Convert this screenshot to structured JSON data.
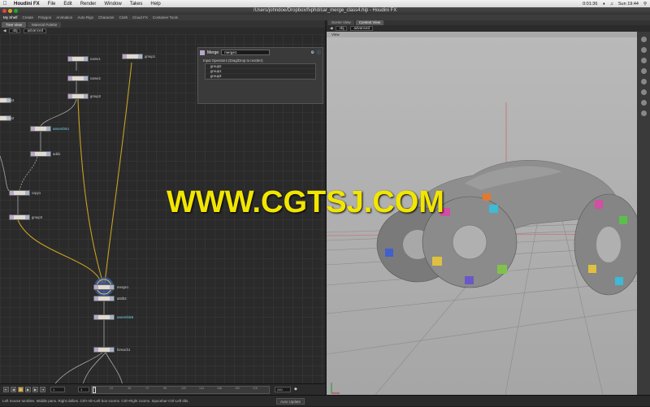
{
  "menubar": {
    "app_name": "Houdini FX",
    "items": [
      "File",
      "Edit",
      "Render",
      "Window",
      "Takes",
      "Help"
    ],
    "clock": "Sun 19:44",
    "timer": "0:01:36"
  },
  "window": {
    "title": "/Users/johndoe/Dropbox/fxphd/car_merge_class4.hip - Houdini FX"
  },
  "houdini_menu": [
    "Create",
    "Polygon",
    "Animation",
    "Auto Rigs",
    "Character",
    "Cloth",
    "Cloud FX",
    "Container Tools"
  ],
  "shelf": {
    "active": "My Shelf"
  },
  "left_pane": {
    "tabs": [
      "Tree View",
      "Material Palette"
    ],
    "path": [
      "obj",
      "advanced"
    ]
  },
  "nodes": [
    {
      "id": "name1",
      "label": "name1"
    },
    {
      "id": "name2",
      "label": "name2"
    },
    {
      "id": "group1",
      "label": "group1"
    },
    {
      "id": "group2",
      "label": "group2"
    },
    {
      "id": "fuse3",
      "label": "fuse3"
    },
    {
      "id": "fuse2",
      "label": "fuse2"
    },
    {
      "id": "assemble1",
      "label": "assemble1"
    },
    {
      "id": "add1",
      "label": "add1"
    },
    {
      "id": "copy1",
      "label": "copy1"
    },
    {
      "id": "group3",
      "label": "group3"
    },
    {
      "id": "merge1",
      "label": "merge1"
    },
    {
      "id": "attrib3",
      "label": "attrib3"
    },
    {
      "id": "assemble5",
      "label": "assemble5"
    },
    {
      "id": "foreach1",
      "label": "foreach1"
    }
  ],
  "params": {
    "type": "Merge",
    "node_name": "merge1",
    "section": "Input Operators (Drag/Drop to reorder)",
    "inputs": [
      "group2",
      "group1",
      "group3"
    ]
  },
  "right_pane": {
    "tabs": [
      "Scene View",
      "Context View"
    ],
    "path": [
      "obj",
      "advanced"
    ],
    "view_label": "View"
  },
  "timeline": {
    "start": "1",
    "current": "1",
    "end": "240",
    "ticks": [
      "1",
      "24",
      "48",
      "72",
      "96",
      "120",
      "144",
      "168",
      "192",
      "216"
    ]
  },
  "status": {
    "hint": "Left mouse tumbles. Middle pans. Right dollies. Ctrl+Alt+Left box-zooms. Ctrl+Right zooms. Spacebar-Ctrl-Left tilts.",
    "auto_update": "Auto Update"
  },
  "watermark": "WWW.CGTSJ.COM",
  "colors": {
    "accent": "#e0b400",
    "wire": "#c8a020",
    "watermark": "#f2e600"
  }
}
